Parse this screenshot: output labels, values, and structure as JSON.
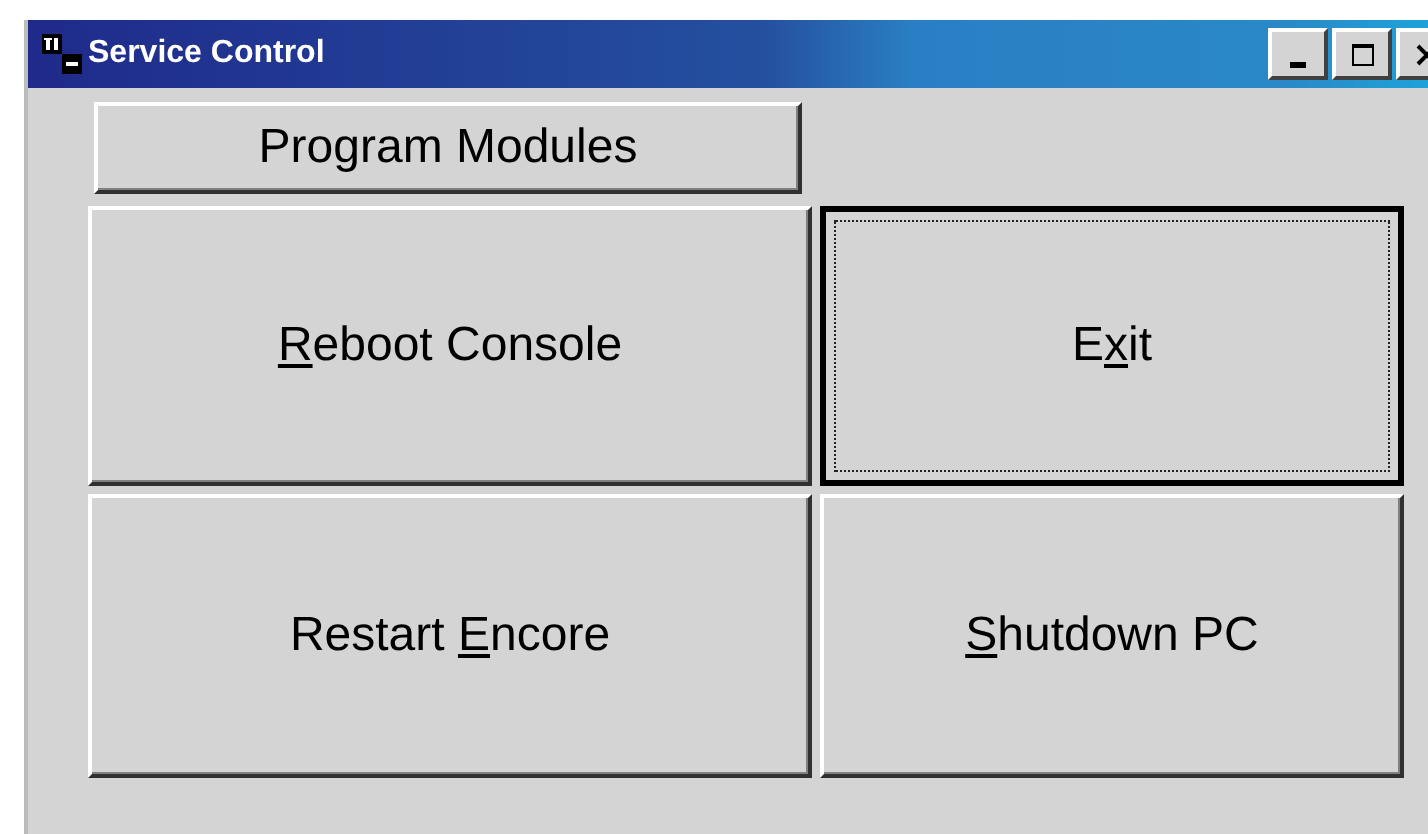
{
  "window": {
    "title": "Service Control"
  },
  "group_button": {
    "label": "Program Modules"
  },
  "buttons": [
    {
      "label": [
        {
          "text": "R",
          "underlined": true
        },
        {
          "text": "eboot Console",
          "underlined": false
        }
      ],
      "focused": false
    },
    {
      "label": [
        {
          "text": "E",
          "underlined": false
        },
        {
          "text": "x",
          "underlined": true
        },
        {
          "text": "it",
          "underlined": false
        }
      ],
      "focused": true
    },
    {
      "label": [
        {
          "text": "Restart ",
          "underlined": false
        },
        {
          "text": "E",
          "underlined": true
        },
        {
          "text": "ncore",
          "underlined": false
        }
      ],
      "focused": false
    },
    {
      "label": [
        {
          "text": "S",
          "underlined": true
        },
        {
          "text": "hutdown PC",
          "underlined": false
        }
      ],
      "focused": false
    }
  ]
}
